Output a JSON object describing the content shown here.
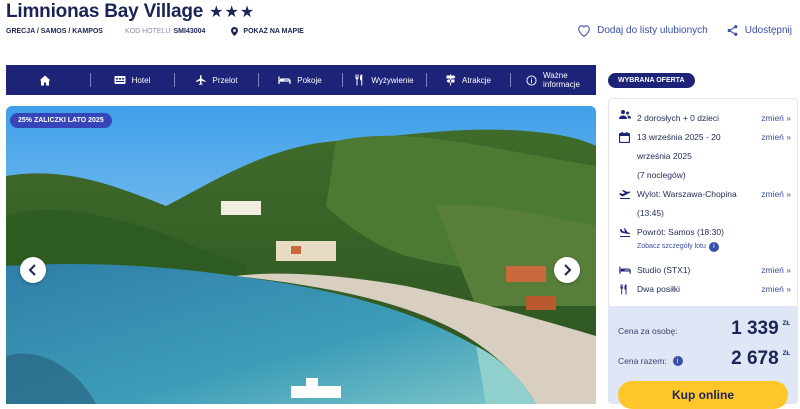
{
  "header": {
    "hotel_name": "Limnionas Bay Village",
    "stars": "★★★",
    "location": "GRECJA / SAMOS / KAMPOS",
    "code_label": "KOD HOTELU",
    "code_value": "SMI43004",
    "map_link": "POKAŻ NA MAPIE",
    "favorite": "Dodaj do listy ulubionych",
    "share": "Udostępnij"
  },
  "nav": {
    "items": [
      {
        "label": "",
        "icon": "home-icon"
      },
      {
        "label": "Hotel",
        "icon": "hotel-icon"
      },
      {
        "label": "Przelot",
        "icon": "plane-icon"
      },
      {
        "label": "Pokoje",
        "icon": "bed-icon"
      },
      {
        "label": "Wyżywienie",
        "icon": "cutlery-icon"
      },
      {
        "label": "Atrakcje",
        "icon": "signpost-icon"
      },
      {
        "label": "Ważne informacje",
        "icon": "info-icon"
      }
    ],
    "important_line1": "Ważne",
    "important_line2": "informacje"
  },
  "hero": {
    "promo": "25% ZALICZKI LATO 2025"
  },
  "offer": {
    "badge": "WYBRANA OFERTA",
    "guests": "2 dorosłych + 0 dzieci",
    "dates_line1": "13 września 2025 - 20",
    "dates_line2": "września 2025",
    "nights": "(7 noclegów)",
    "departure_line1": "Wylot: Warszawa-Chopina",
    "departure_line2": "(13:45)",
    "return": "Powrót: Samos (18:30)",
    "flight_details": "Zobacz szczegóły lotu",
    "room": "Studio (STX1)",
    "board": "Dwa posiłki",
    "change": "zmień »",
    "price_per_person_label": "Cena za osobę:",
    "price_per_person": "1 339",
    "price_total_label": "Cena razem:",
    "price_total": "2 678",
    "currency": "ZŁ",
    "buy": "Kup online"
  },
  "colors": {
    "navy": "#1d2377",
    "accent": "#3a4fa8",
    "buy_button": "#ffc629",
    "price_bg": "#dfe6f6"
  }
}
